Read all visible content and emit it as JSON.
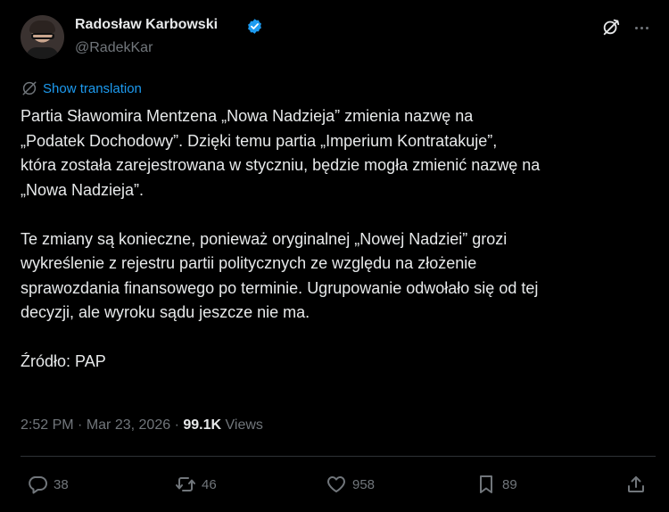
{
  "author": {
    "name": "Radosław Karbowski",
    "handle": "@RadekKar"
  },
  "translate_label": "Show translation",
  "body": {
    "p1_lines": [
      "Partia Sławomira Mentzena „Nowa Nadzieja” zmienia nazwę na",
      "„Podatek Dochodowy”. Dzięki temu partia „Imperium Kontratakuje”,",
      "która została zarejestrowana w styczniu, będzie mogła zmienić nazwę na",
      "„Nowa Nadzieja”."
    ],
    "p2_lines": [
      "Te zmiany są konieczne, ponieważ oryginalnej „Nowej Nadziei” grozi",
      "wykreślenie z rejestru partii politycznych ze względu na złożenie",
      "sprawozdania finansowego po terminie. Ugrupowanie odwołało się od tej",
      "decyzji, ale wyroku sądu jeszcze nie ma."
    ],
    "p3_lines": [
      "Źródło: PAP"
    ]
  },
  "meta": {
    "time": "2:52 PM",
    "date": "Mar 23, 2026",
    "separator": "·",
    "views_count": "99.1K",
    "views_label": "Views"
  },
  "actions": {
    "replies": "38",
    "reposts": "46",
    "likes": "958",
    "bookmarks": "89"
  },
  "colors": {
    "background": "#000000",
    "text": "#e7e9ea",
    "muted": "#71767b",
    "accent": "#1d9bf0"
  },
  "icons": [
    "verified-badge-icon",
    "grok-icon",
    "more-icon",
    "translate-icon",
    "reply-icon",
    "repost-icon",
    "like-icon",
    "bookmark-icon",
    "share-icon"
  ]
}
